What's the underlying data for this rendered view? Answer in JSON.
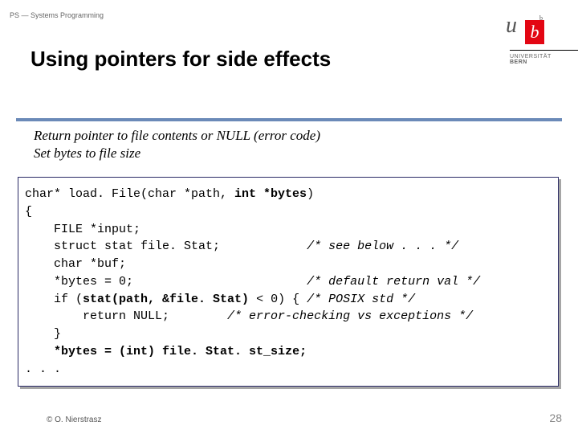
{
  "header": {
    "course_label": "PS — Systems Programming",
    "slide_title": "Using pointers for side effects",
    "logo": {
      "u": "u",
      "b_sup": "b",
      "b": "b",
      "uni_line1": "UNIVERSITÄT",
      "uni_line2": "BERN"
    }
  },
  "description": {
    "line1": "Return pointer to file contents or NULL (error code)",
    "line2": "Set bytes to file size"
  },
  "code": {
    "l1_prefix": "char* load. File(char *path, ",
    "l1_bold": "int *bytes",
    "l1_suffix": ")",
    "l2": "{",
    "l3": "    FILE *input;",
    "l4_code": "    struct stat file. Stat;",
    "l4_pad": "            ",
    "l4_cmt": "/* see below . . . */",
    "l5": "    char *buf;",
    "l6_code": "    *bytes = 0;",
    "l6_pad": "                        ",
    "l6_cmt": "/* default return val */",
    "l7_prefix": "    if (",
    "l7_bold": "stat(path, &file. Stat)",
    "l7_mid": " < 0) { ",
    "l7_cmt": "/* POSIX std */",
    "l8_code": "        return NULL;",
    "l8_pad": "        ",
    "l8_cmt": "/* error-checking vs exceptions */",
    "l9": "    }",
    "l10_pad": "    ",
    "l10_bold": "*bytes = (int) file. Stat. st_size;",
    "l11": ". . ."
  },
  "footer": {
    "copyright": "© O. Nierstrasz",
    "page": "28"
  }
}
